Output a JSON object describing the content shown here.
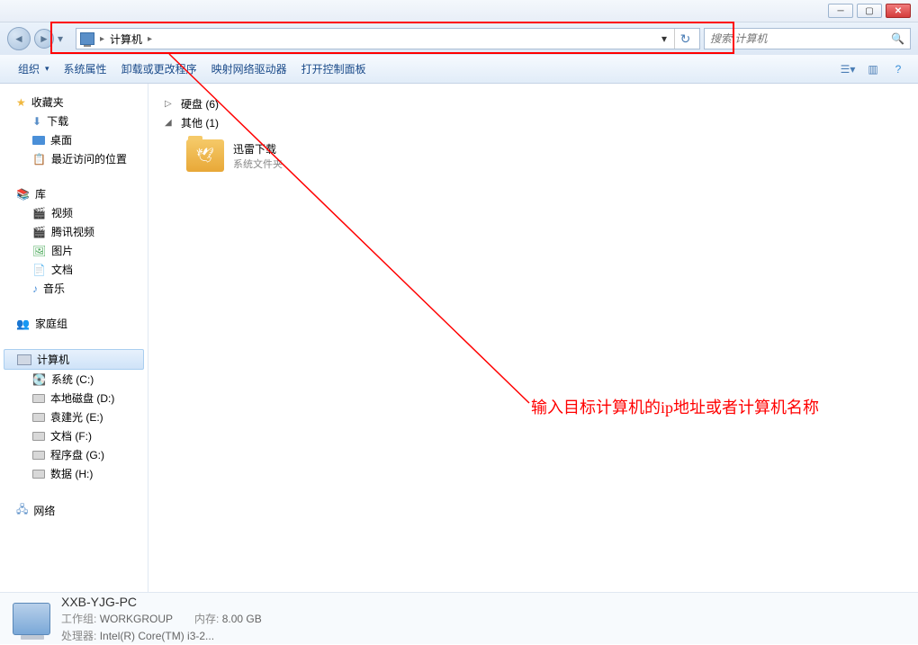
{
  "address": {
    "path": "计算机",
    "separator": "▸"
  },
  "search": {
    "placeholder": "搜索 计算机"
  },
  "toolbar": {
    "organize": "组织",
    "sysprops": "系统属性",
    "uninstall": "卸载或更改程序",
    "mapnet": "映射网络驱动器",
    "control": "打开控制面板"
  },
  "sidebar": {
    "favorites": {
      "label": "收藏夹",
      "items": [
        "下载",
        "桌面",
        "最近访问的位置"
      ]
    },
    "libs": {
      "label": "库",
      "items": [
        "视频",
        "腾讯视频",
        "图片",
        "文档",
        "音乐"
      ]
    },
    "homegroup": "家庭组",
    "computer": {
      "label": "计算机",
      "drives": [
        "系统 (C:)",
        "本地磁盘 (D:)",
        "袁建光 (E:)",
        "文档 (F:)",
        "程序盘 (G:)",
        "数据 (H:)"
      ]
    },
    "network": "网络"
  },
  "content": {
    "group1": {
      "label": "硬盘",
      "count": "(6)"
    },
    "group2": {
      "label": "其他",
      "count": "(1)"
    },
    "folder": {
      "name": "迅雷下载",
      "type": "系统文件夹"
    }
  },
  "status": {
    "name": "XXB-YJG-PC",
    "workgroup_label": "工作组:",
    "workgroup": "WORKGROUP",
    "mem_label": "内存:",
    "mem": "8.00 GB",
    "cpu_label": "处理器:",
    "cpu": "Intel(R) Core(TM) i3-2..."
  },
  "annotation": {
    "text": "输入目标计算机的ip地址或者计算机名称"
  }
}
